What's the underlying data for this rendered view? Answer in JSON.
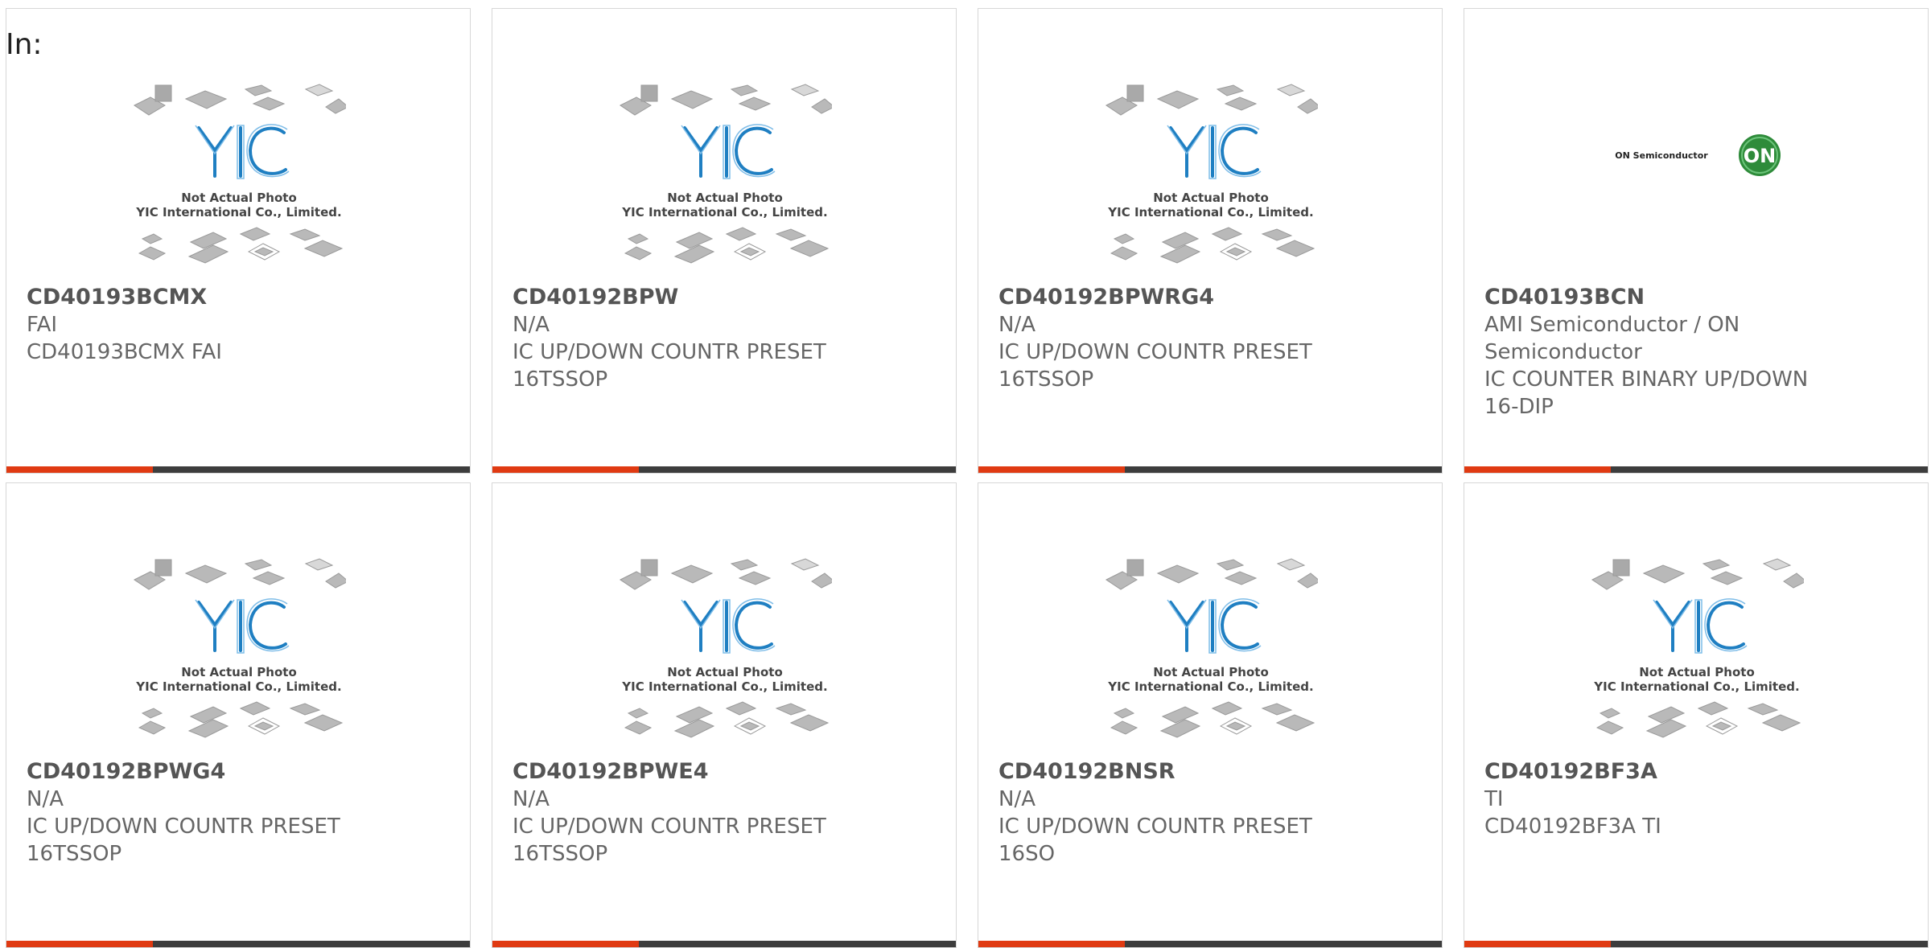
{
  "filter_label": "In:",
  "placeholder": {
    "line1": "Not Actual Photo",
    "line2": "YIC International Co., Limited.",
    "logo": "YIC"
  },
  "on_logo": {
    "text": "ON Semiconductor",
    "mark": "ON"
  },
  "colors": {
    "accent": "#e03a12",
    "bar": "#3d3d3d",
    "yic_blue": "#1f7fc2",
    "on_green": "#2e8b3a"
  },
  "products": [
    {
      "part_number": "CD40193BCMX",
      "manufacturer": "FAI",
      "description": "CD40193BCMX FAI",
      "image": "yic-placeholder"
    },
    {
      "part_number": "CD40192BPW",
      "manufacturer": "N/A",
      "description": "IC UP/DOWN COUNTR PRESET 16TSSOP",
      "image": "yic-placeholder"
    },
    {
      "part_number": "CD40192BPWRG4",
      "manufacturer": "N/A",
      "description": "IC UP/DOWN COUNTR PRESET 16TSSOP",
      "image": "yic-placeholder"
    },
    {
      "part_number": "CD40193BCN",
      "manufacturer": "AMI Semiconductor / ON Semiconductor",
      "description": "IC COUNTER BINARY UP/DOWN 16-DIP",
      "image": "on-semiconductor-logo"
    },
    {
      "part_number": "CD40192BPWG4",
      "manufacturer": "N/A",
      "description": "IC UP/DOWN COUNTR PRESET 16TSSOP",
      "image": "yic-placeholder"
    },
    {
      "part_number": "CD40192BPWE4",
      "manufacturer": "N/A",
      "description": "IC UP/DOWN COUNTR PRESET 16TSSOP",
      "image": "yic-placeholder"
    },
    {
      "part_number": "CD40192BNSR",
      "manufacturer": "N/A",
      "description": "IC UP/DOWN COUNTR PRESET 16SO",
      "image": "yic-placeholder"
    },
    {
      "part_number": "CD40192BF3A",
      "manufacturer": "TI",
      "description": "CD40192BF3A TI",
      "image": "yic-placeholder"
    }
  ]
}
